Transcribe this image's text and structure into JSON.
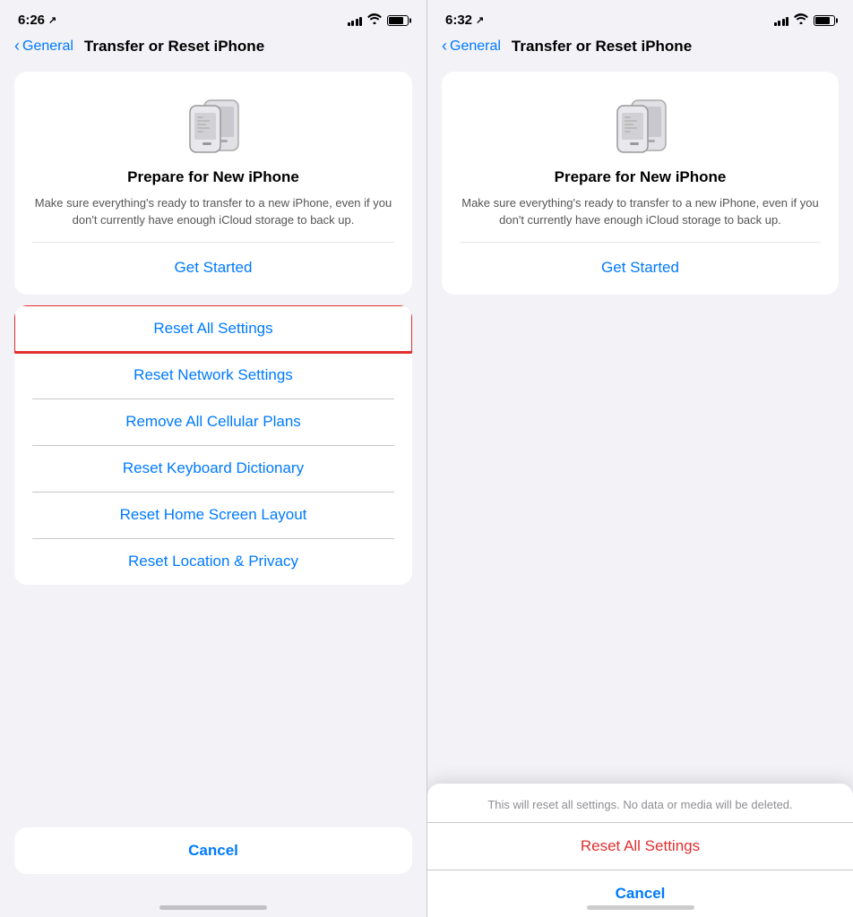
{
  "left_panel": {
    "status": {
      "time": "6:26",
      "location_arrow": "⇗"
    },
    "nav": {
      "back_label": "General",
      "title": "Transfer or Reset iPhone"
    },
    "prepare_card": {
      "title": "Prepare for New iPhone",
      "description": "Make sure everything's ready to transfer to a new iPhone, even if you don't currently have enough iCloud storage to back up.",
      "get_started": "Get Started"
    },
    "reset_items": [
      {
        "label": "Reset All Settings",
        "highlighted": true
      },
      {
        "label": "Reset Network Settings",
        "highlighted": false
      },
      {
        "label": "Remove All Cellular Plans",
        "highlighted": false
      },
      {
        "label": "Reset Keyboard Dictionary",
        "highlighted": false
      },
      {
        "label": "Reset Home Screen Layout",
        "highlighted": false
      },
      {
        "label": "Reset Location & Privacy",
        "highlighted": false
      }
    ],
    "cancel_label": "Cancel"
  },
  "right_panel": {
    "status": {
      "time": "6:32",
      "location_arrow": "⇗"
    },
    "nav": {
      "back_label": "General",
      "title": "Transfer or Reset iPhone"
    },
    "prepare_card": {
      "title": "Prepare for New iPhone",
      "description": "Make sure everything's ready to transfer to a new iPhone, even if you don't currently have enough iCloud storage to back up.",
      "get_started": "Get Started"
    },
    "dialog": {
      "message": "This will reset all settings. No data or media will be deleted.",
      "reset_label": "Reset All Settings",
      "cancel_label": "Cancel"
    }
  }
}
